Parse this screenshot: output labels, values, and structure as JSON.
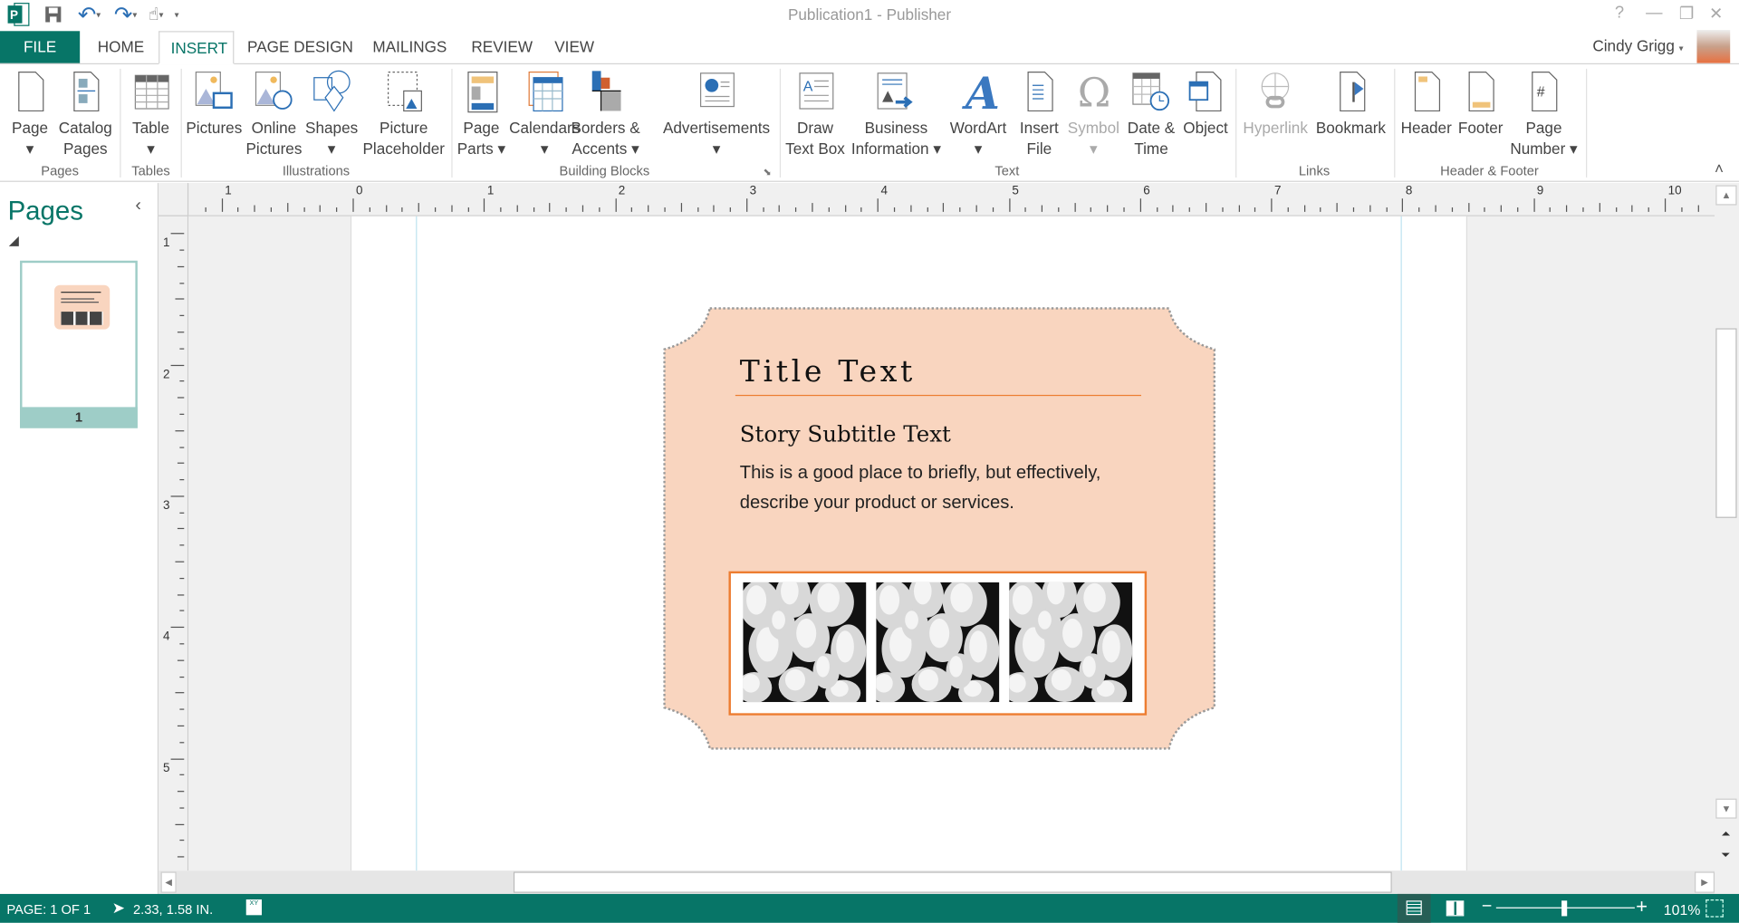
{
  "window": {
    "title": "Publication1 - Publisher",
    "help": "?",
    "user": "Cindy Grigg"
  },
  "tabs": [
    {
      "label": "FILE"
    },
    {
      "label": "HOME"
    },
    {
      "label": "INSERT"
    },
    {
      "label": "PAGE DESIGN"
    },
    {
      "label": "MAILINGS"
    },
    {
      "label": "REVIEW"
    },
    {
      "label": "VIEW"
    }
  ],
  "active_tab": "INSERT",
  "ribbon": {
    "groups": [
      {
        "label": "Pages"
      },
      {
        "label": "Tables"
      },
      {
        "label": "Illustrations"
      },
      {
        "label": "Building Blocks"
      },
      {
        "label": "Text"
      },
      {
        "label": "Links"
      },
      {
        "label": "Header & Footer"
      }
    ],
    "buttons": [
      {
        "l1": "Page",
        "l2": "▾",
        "icon": "page-icon"
      },
      {
        "l1": "Catalog",
        "l2": "Pages",
        "icon": "catalog-pages-icon"
      },
      {
        "l1": "Table",
        "l2": "▾",
        "icon": "table-icon"
      },
      {
        "l1": "Pictures",
        "l2": "",
        "icon": "pictures-icon"
      },
      {
        "l1": "Online",
        "l2": "Pictures",
        "icon": "online-pictures-icon"
      },
      {
        "l1": "Shapes",
        "l2": "▾",
        "icon": "shapes-icon"
      },
      {
        "l1": "Picture",
        "l2": "Placeholder",
        "icon": "picture-placeholder-icon"
      },
      {
        "l1": "Page",
        "l2": "Parts ▾",
        "icon": "page-parts-icon"
      },
      {
        "l1": "Calendars",
        "l2": "▾",
        "icon": "calendars-icon"
      },
      {
        "l1": "Borders &",
        "l2": "Accents ▾",
        "icon": "borders-accents-icon"
      },
      {
        "l1": "Advertisements",
        "l2": "▾",
        "icon": "advertisements-icon"
      },
      {
        "l1": "Draw",
        "l2": "Text Box",
        "icon": "draw-text-box-icon"
      },
      {
        "l1": "Business",
        "l2": "Information ▾",
        "icon": "business-information-icon"
      },
      {
        "l1": "WordArt",
        "l2": "▾",
        "icon": "wordart-icon"
      },
      {
        "l1": "Insert",
        "l2": "File",
        "icon": "insert-file-icon"
      },
      {
        "l1": "Symbol",
        "l2": "▾",
        "icon": "symbol-icon",
        "disabled": true
      },
      {
        "l1": "Date &",
        "l2": "Time",
        "icon": "date-time-icon"
      },
      {
        "l1": "Object",
        "l2": "",
        "icon": "object-icon"
      },
      {
        "l1": "Hyperlink",
        "l2": "",
        "icon": "hyperlink-icon",
        "disabled": true
      },
      {
        "l1": "Bookmark",
        "l2": "",
        "icon": "bookmark-icon"
      },
      {
        "l1": "Header",
        "l2": "",
        "icon": "header-icon"
      },
      {
        "l1": "Footer",
        "l2": "",
        "icon": "footer-icon"
      },
      {
        "l1": "Page",
        "l2": "Number ▾",
        "icon": "page-number-icon"
      }
    ]
  },
  "pages_pane": {
    "title": "Pages",
    "thumb_label": "1"
  },
  "ruler": {
    "h_labels": [
      "1",
      "0",
      "1",
      "2",
      "3",
      "4",
      "5",
      "6",
      "7",
      "8",
      "9",
      "10"
    ],
    "v_labels": [
      "1",
      "2",
      "3",
      "4",
      "5"
    ]
  },
  "publication": {
    "title": "Title Text",
    "subtitle": "Story Subtitle Text",
    "body_line1": "This is a good place to briefly, but effectively,",
    "body_line2": "describe your product or services.",
    "fill_color": "#f9d5bf",
    "accent_color": "#ed7d31"
  },
  "status": {
    "page": "PAGE: 1 OF 1",
    "position": "2.33, 1.58 IN.",
    "zoom": "101%",
    "zoom_percent": 101
  },
  "colors": {
    "brand": "#077567"
  }
}
